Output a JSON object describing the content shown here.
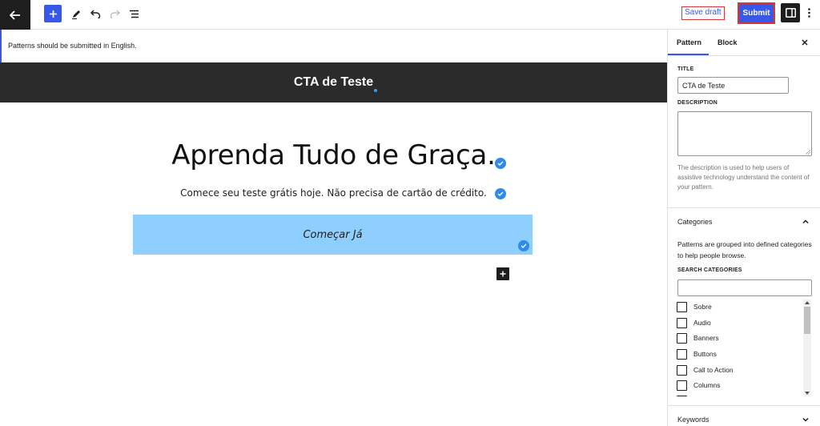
{
  "toolbar": {
    "save_draft_label": "Save draft",
    "submit_label": "Submit"
  },
  "notice": {
    "text": "Patterns should be submitted in English."
  },
  "canvas": {
    "header_title": "CTA de Teste",
    "headline": "Aprenda Tudo de Graça.",
    "subtext": "Comece seu teste grátis hoje. Não precisa de cartão de crédito.",
    "button_text": "Começar Já"
  },
  "sidebar": {
    "tabs": [
      {
        "label": "Pattern"
      },
      {
        "label": "Block"
      }
    ],
    "title_label": "TITLE",
    "title_value": "CTA de Teste",
    "description_label": "DESCRIPTION",
    "description_help": "The description is used to help users of assistive technology understand the content of your pattern.",
    "categories": {
      "title": "Categories",
      "help": "Patterns are grouped into defined categories to help people browse.",
      "search_label": "SEARCH CATEGORIES",
      "items": [
        {
          "label": "Sobre"
        },
        {
          "label": "Audio"
        },
        {
          "label": "Banners"
        },
        {
          "label": "Buttons"
        },
        {
          "label": "Call to Action"
        },
        {
          "label": "Columns"
        }
      ]
    },
    "keywords_title": "Keywords"
  },
  "colors": {
    "accent": "#3858e9",
    "header_band": "#2b2b2b",
    "cta_block": "#8ecfff",
    "highlight_border": "#d63638"
  },
  "icons": [
    "back-arrow-icon",
    "plus-icon",
    "pen-icon",
    "undo-icon",
    "redo-icon",
    "list-view-icon",
    "sidebar-icon",
    "more-vertical-icon",
    "check-icon",
    "close-icon",
    "chevron-up-icon",
    "chevron-down-icon"
  ]
}
